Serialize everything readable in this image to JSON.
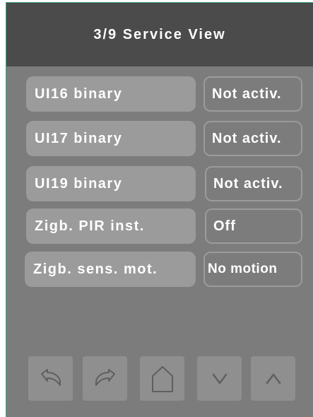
{
  "header": {
    "title": "3/9 Service View"
  },
  "rows": [
    {
      "label": "UI16 binary",
      "value": "Not activ."
    },
    {
      "label": "UI17 binary",
      "value": "Not activ."
    },
    {
      "label": "UI19 binary",
      "value": "Not activ."
    },
    {
      "label": "Zigb. PIR inst.",
      "value": "Off"
    },
    {
      "label": "Zigb. sens. mot.",
      "value": "No motion"
    }
  ],
  "nav": {
    "buttons": [
      {
        "icon": "undo-icon"
      },
      {
        "icon": "redo-icon"
      },
      {
        "icon": "home-icon"
      },
      {
        "icon": "chevron-down-icon"
      },
      {
        "icon": "chevron-up-icon"
      }
    ]
  },
  "colors": {
    "background": "#7c7c7c",
    "header": "#4b4b4b",
    "field": "#9b9b9b",
    "text": "#ffffff",
    "icon": "#5f5f5f"
  }
}
